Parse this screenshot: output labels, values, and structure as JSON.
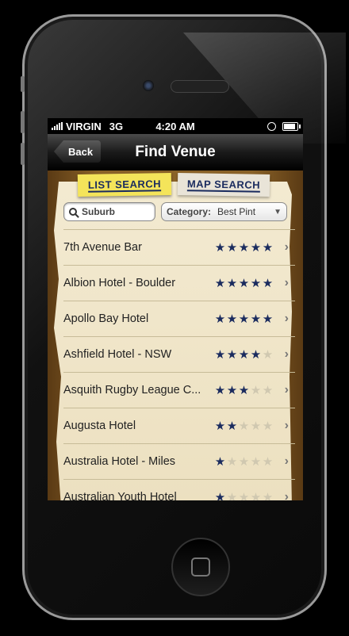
{
  "status": {
    "carrier": "VIRGIN",
    "network": "3G",
    "time": "4:20 AM"
  },
  "navbar": {
    "back_label": "Back",
    "title": "Find Venue"
  },
  "tabs": {
    "list_label": "LIST SEARCH",
    "map_label": "MAP SEARCH",
    "active": "list"
  },
  "search": {
    "placeholder": "Suburb"
  },
  "category": {
    "label": "Category:",
    "value": "Best Pint"
  },
  "colors": {
    "star_on": "#1a2b5e",
    "star_off": "#d0c8b0",
    "tab_active": "#f4e45a"
  },
  "venues": [
    {
      "name": "7th Avenue Bar",
      "rating": 5
    },
    {
      "name": "Albion Hotel - Boulder",
      "rating": 5
    },
    {
      "name": "Apollo Bay Hotel",
      "rating": 5
    },
    {
      "name": "Ashfield Hotel - NSW",
      "rating": 4
    },
    {
      "name": "Asquith Rugby League C...",
      "rating": 3
    },
    {
      "name": "Augusta Hotel",
      "rating": 2
    },
    {
      "name": "Australia Hotel - Miles",
      "rating": 1
    },
    {
      "name": "Australian Youth Hotel",
      "rating": 1
    }
  ]
}
